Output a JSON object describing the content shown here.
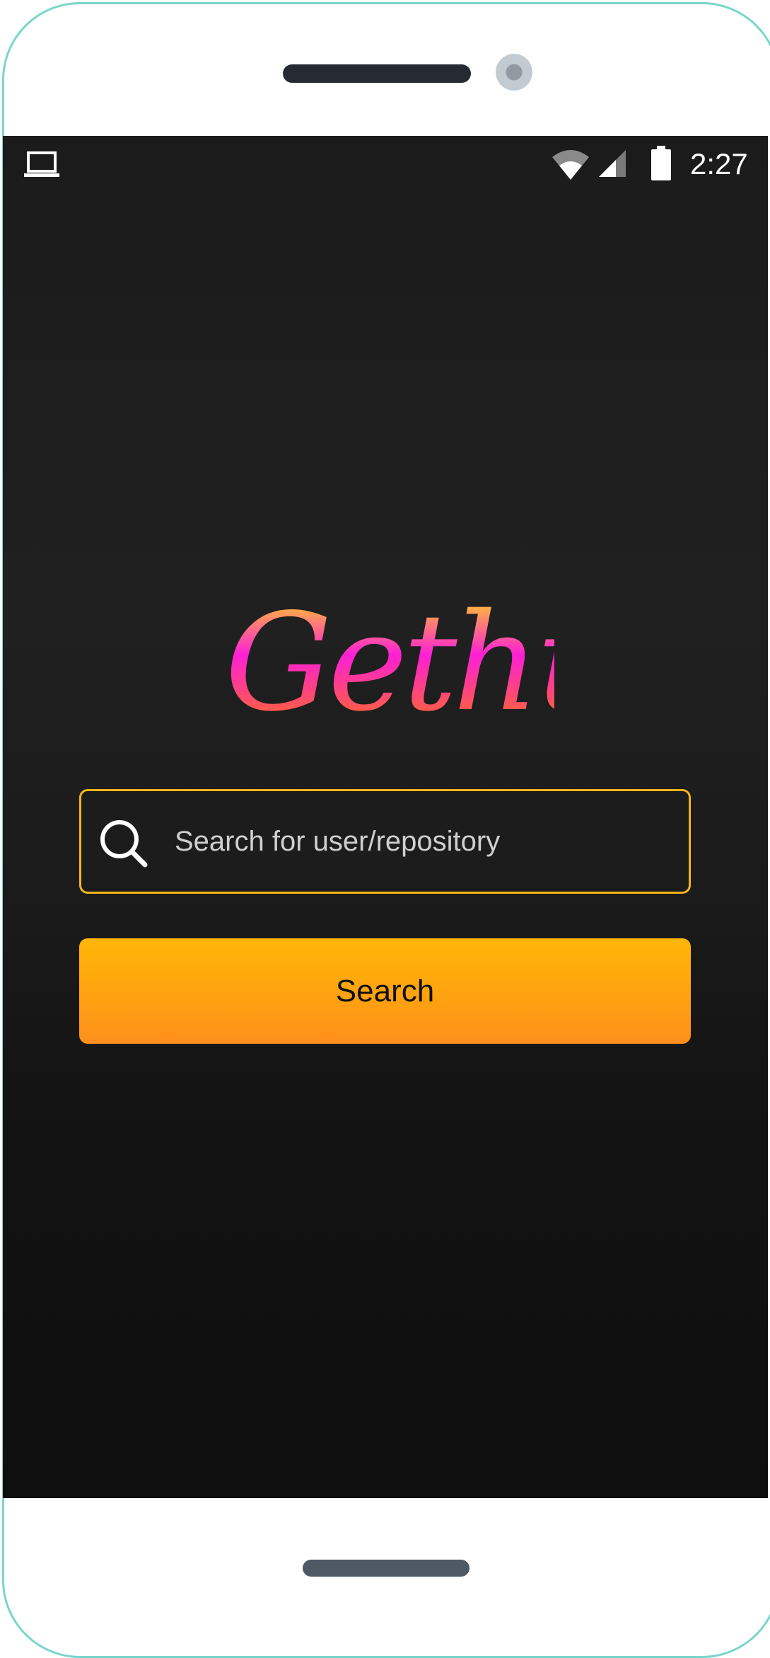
{
  "status_bar": {
    "time": "2:27",
    "left_icon": "laptop-icon",
    "wifi_icon": "wifi-icon",
    "signal_icon": "cell-signal-icon",
    "battery_icon": "battery-icon"
  },
  "logo": {
    "text": "Gethub",
    "gradient": [
      "#fff200",
      "#ff1fd6",
      "#ff7a00"
    ]
  },
  "search": {
    "placeholder": "Search for user/repository",
    "value": "",
    "icon": "search-icon",
    "border_color": "#f7b41a"
  },
  "search_button": {
    "label": "Search",
    "color": "#ffa812"
  },
  "colors": {
    "background": "#1b1b1b",
    "accent": "#f7b41a"
  }
}
